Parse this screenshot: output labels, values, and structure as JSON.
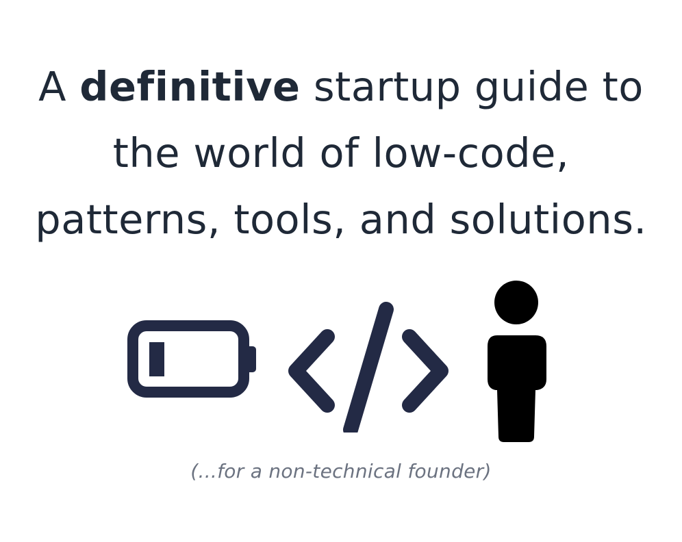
{
  "headline": {
    "line1_prefix": "A ",
    "line1_bold": "definitive",
    "line1_suffix": " startup guide to",
    "line2": "the world of low-code,",
    "line3": "patterns, tools, and solutions."
  },
  "icons": [
    "low-battery-icon",
    "code-brackets-icon",
    "person-icon"
  ],
  "colors": {
    "text": "#1f2937",
    "icon_navy": "#232a45",
    "icon_black": "#000000",
    "caption": "#6b7280"
  },
  "caption": "(...for a non-technical founder)"
}
